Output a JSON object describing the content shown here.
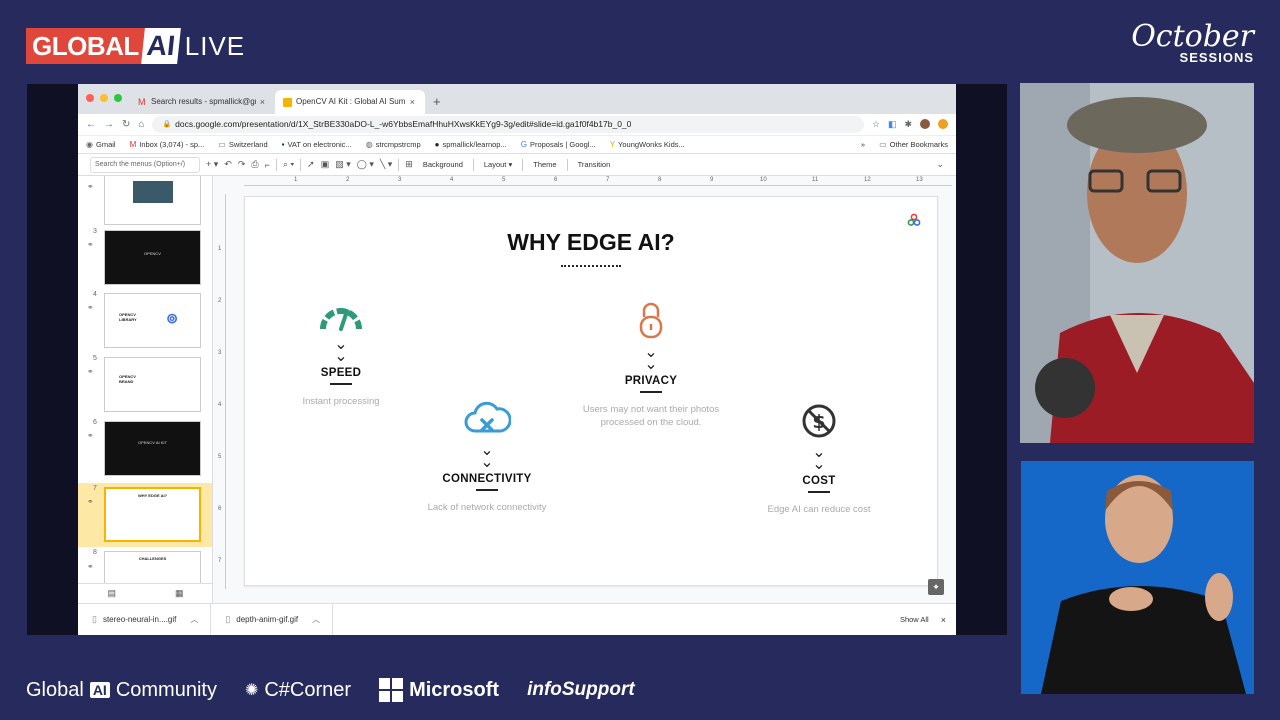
{
  "broadcast": {
    "brand_global": "GLOBAL",
    "brand_ai": "AI",
    "brand_live": "LIVE",
    "event_line1": "October",
    "event_line2": "SESSIONS",
    "sponsors": {
      "global_ai_pre": "Global",
      "global_ai_mid": "AI",
      "global_ai_post": "Community",
      "csharp": "C#Corner",
      "microsoft": "Microsoft",
      "infosupport": "infoSupport"
    }
  },
  "browser": {
    "tabs": [
      {
        "label": "Search results - spmallick@gm",
        "close": "×"
      },
      {
        "label": "OpenCV AI Kit : Global AI Sum",
        "close": "×"
      }
    ],
    "new_tab": "+",
    "url": "docs.google.com/presentation/d/1X_StrBE330aDO-L_-w6YbbsEmafHhuHXwsKkEYg9-3g/edit#slide=id.ga1f0f4b17b_0_0",
    "bookmarks": [
      {
        "label": "Gmail",
        "icon": "gmail-icon"
      },
      {
        "label": "Inbox (3,074) - sp...",
        "icon": "mail-icon"
      },
      {
        "label": "Switzerland",
        "icon": "folder-icon"
      },
      {
        "label": "VAT on electronic...",
        "icon": "flag-icon"
      },
      {
        "label": "strcmpstrcmp",
        "icon": "globe-icon"
      },
      {
        "label": "spmallick/learnop...",
        "icon": "github-icon"
      },
      {
        "label": "Proposals | Googl...",
        "icon": "google-icon"
      },
      {
        "label": "YoungWonks Kids...",
        "icon": "y-icon"
      }
    ],
    "bookmarks_more": "»",
    "other_bookmarks": "Other Bookmarks"
  },
  "slides_toolbar": {
    "menu_search_placeholder": "Search the menus (Option+/)",
    "background": "Background",
    "layout": "Layout ▾",
    "theme": "Theme",
    "transition": "Transition"
  },
  "filmstrip": {
    "slides": [
      {
        "num": "",
        "title": ""
      },
      {
        "num": "3",
        "title": "OPENCV"
      },
      {
        "num": "4",
        "title": "OPENCV LIBRARY"
      },
      {
        "num": "5",
        "title": "OPENCV BRAND"
      },
      {
        "num": "6",
        "title": "OPENCV AI KIT"
      },
      {
        "num": "7",
        "title": "WHY EDGE AI?"
      },
      {
        "num": "8",
        "title": "CHALLENGES"
      }
    ]
  },
  "ruler_top": [
    "1",
    "2",
    "3",
    "4",
    "5",
    "6",
    "7",
    "8",
    "9",
    "10",
    "11",
    "12",
    "13"
  ],
  "ruler_left": [
    "1",
    "2",
    "3",
    "4",
    "5",
    "6",
    "7"
  ],
  "slide": {
    "title": "WHY EDGE AI?",
    "items": {
      "speed": {
        "label": "SPEED",
        "desc": "Instant processing",
        "color": "#2e9a7a"
      },
      "privacy": {
        "label": "PRIVACY",
        "desc_line1": "Users may not want their photos",
        "desc_line2": "processed on the cloud.",
        "color": "#d9774a"
      },
      "connectivity": {
        "label": "CONNECTIVITY",
        "desc": "Lack of network connectivity",
        "color": "#3a9bd5"
      },
      "cost": {
        "label": "COST",
        "desc": "Edge AI can reduce cost",
        "color": "#333333"
      }
    }
  },
  "downloads": [
    {
      "name": "stereo-neural-in....gif"
    },
    {
      "name": "depth-anim-gif.gif"
    }
  ],
  "show_all": "Show All",
  "downloads_close": "×"
}
